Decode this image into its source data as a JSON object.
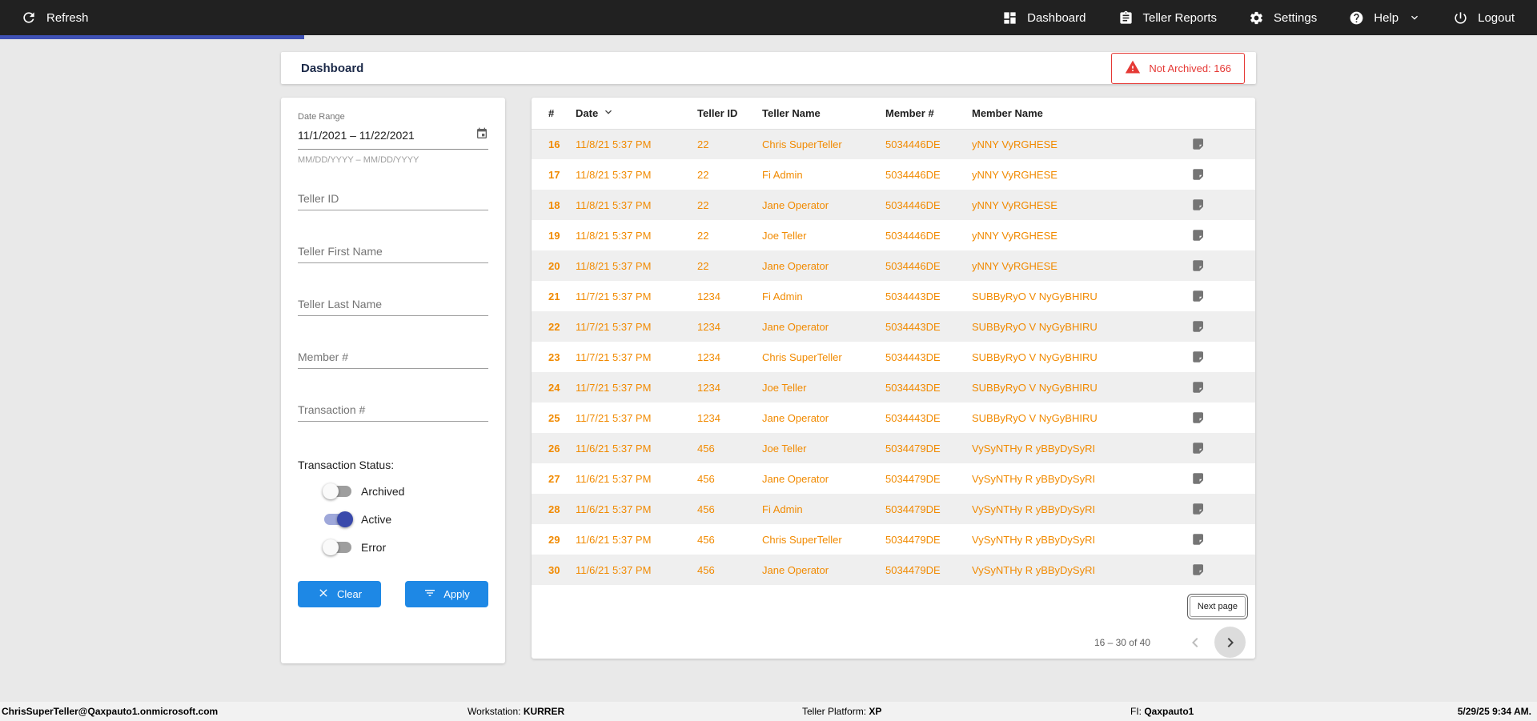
{
  "topbar": {
    "refresh_label": "Refresh",
    "nav": [
      {
        "label": "Dashboard"
      },
      {
        "label": "Teller Reports"
      },
      {
        "label": "Settings"
      },
      {
        "label": "Help"
      },
      {
        "label": "Logout"
      }
    ]
  },
  "header": {
    "title": "Dashboard",
    "not_archived": "Not Archived: 166"
  },
  "filters": {
    "date_range": {
      "label": "Date Range",
      "value": "11/1/2021 – 11/22/2021",
      "hint": "MM/DD/YYYY – MM/DD/YYYY"
    },
    "inputs": [
      {
        "placeholder": "Teller ID"
      },
      {
        "placeholder": "Teller First Name"
      },
      {
        "placeholder": "Teller Last Name"
      },
      {
        "placeholder": "Member #"
      },
      {
        "placeholder": "Transaction #"
      }
    ],
    "status_label": "Transaction Status:",
    "statuses": [
      {
        "label": "Archived",
        "on": false
      },
      {
        "label": "Active",
        "on": true
      },
      {
        "label": "Error",
        "on": false
      }
    ],
    "buttons": {
      "clear": "Clear",
      "apply": "Apply"
    }
  },
  "table": {
    "columns": [
      "#",
      "Date",
      "Teller ID",
      "Teller Name",
      "Member #",
      "Member Name"
    ],
    "sort_column": "Date",
    "rows": [
      {
        "num": "16",
        "date": "11/8/21 5:37 PM",
        "teller_id": "22",
        "teller_name": "Chris SuperTeller",
        "member_num": "5034446DE",
        "member_name": "yNNY VyRGHESE"
      },
      {
        "num": "17",
        "date": "11/8/21 5:37 PM",
        "teller_id": "22",
        "teller_name": "Fi Admin",
        "member_num": "5034446DE",
        "member_name": "yNNY VyRGHESE"
      },
      {
        "num": "18",
        "date": "11/8/21 5:37 PM",
        "teller_id": "22",
        "teller_name": "Jane Operator",
        "member_num": "5034446DE",
        "member_name": "yNNY VyRGHESE"
      },
      {
        "num": "19",
        "date": "11/8/21 5:37 PM",
        "teller_id": "22",
        "teller_name": "Joe Teller",
        "member_num": "5034446DE",
        "member_name": "yNNY VyRGHESE"
      },
      {
        "num": "20",
        "date": "11/8/21 5:37 PM",
        "teller_id": "22",
        "teller_name": "Jane Operator",
        "member_num": "5034446DE",
        "member_name": "yNNY VyRGHESE"
      },
      {
        "num": "21",
        "date": "11/7/21 5:37 PM",
        "teller_id": "1234",
        "teller_name": "Fi Admin",
        "member_num": "5034443DE",
        "member_name": "SUBByRyO V NyGyBHIRU"
      },
      {
        "num": "22",
        "date": "11/7/21 5:37 PM",
        "teller_id": "1234",
        "teller_name": "Jane Operator",
        "member_num": "5034443DE",
        "member_name": "SUBByRyO V NyGyBHIRU"
      },
      {
        "num": "23",
        "date": "11/7/21 5:37 PM",
        "teller_id": "1234",
        "teller_name": "Chris SuperTeller",
        "member_num": "5034443DE",
        "member_name": "SUBByRyO V NyGyBHIRU"
      },
      {
        "num": "24",
        "date": "11/7/21 5:37 PM",
        "teller_id": "1234",
        "teller_name": "Joe Teller",
        "member_num": "5034443DE",
        "member_name": "SUBByRyO V NyGyBHIRU"
      },
      {
        "num": "25",
        "date": "11/7/21 5:37 PM",
        "teller_id": "1234",
        "teller_name": "Jane Operator",
        "member_num": "5034443DE",
        "member_name": "SUBByRyO V NyGyBHIRU"
      },
      {
        "num": "26",
        "date": "11/6/21 5:37 PM",
        "teller_id": "456",
        "teller_name": "Joe Teller",
        "member_num": "5034479DE",
        "member_name": "VySyNTHy R yBByDySyRI"
      },
      {
        "num": "27",
        "date": "11/6/21 5:37 PM",
        "teller_id": "456",
        "teller_name": "Jane Operator",
        "member_num": "5034479DE",
        "member_name": "VySyNTHy R yBByDySyRI"
      },
      {
        "num": "28",
        "date": "11/6/21 5:37 PM",
        "teller_id": "456",
        "teller_name": "Fi Admin",
        "member_num": "5034479DE",
        "member_name": "VySyNTHy R yBByDySyRI"
      },
      {
        "num": "29",
        "date": "11/6/21 5:37 PM",
        "teller_id": "456",
        "teller_name": "Chris SuperTeller",
        "member_num": "5034479DE",
        "member_name": "VySyNTHy R yBByDySyRI"
      },
      {
        "num": "30",
        "date": "11/6/21 5:37 PM",
        "teller_id": "456",
        "teller_name": "Jane Operator",
        "member_num": "5034479DE",
        "member_name": "VySyNTHy R yBByDySyRI"
      }
    ],
    "pagination": {
      "next_label": "Next page",
      "range": "16 – 30 of 40"
    }
  },
  "statusbar": {
    "user": "ChrisSuperTeller@Qaxpauto1.onmicrosoft.com",
    "workstation_label": "Workstation: ",
    "workstation": "KURRER",
    "platform_label": "Teller Platform: ",
    "platform": "XP",
    "fi_label": "FI: ",
    "fi": "Qaxpauto1",
    "datetime": "5/29/25 9:34 AM."
  },
  "colors": {
    "accent": "#3f51b5",
    "primary_button": "#1e88e5",
    "row_text": "#f18a00",
    "alert": "#e53935",
    "topbar_bg": "#212121"
  }
}
